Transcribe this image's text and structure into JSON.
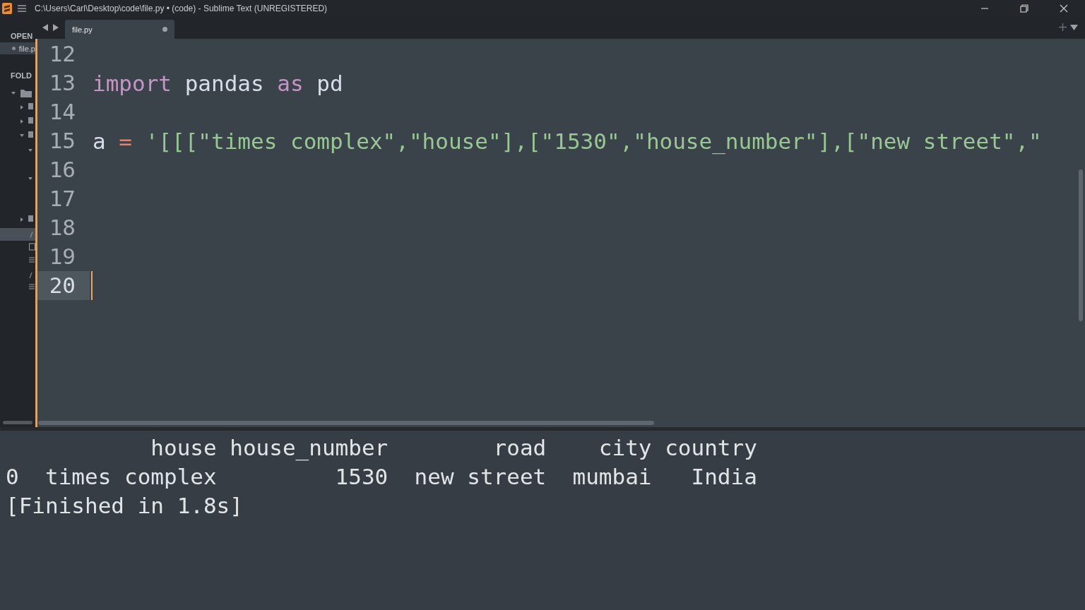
{
  "window": {
    "title": "C:\\Users\\Carl\\Desktop\\code\\file.py • (code) - Sublime Text (UNREGISTERED)"
  },
  "sidebar": {
    "open_label": "OPEN",
    "open_files": [
      {
        "name": "file.p",
        "selected": true
      }
    ],
    "folders_label": "FOLD"
  },
  "tabs": [
    {
      "label": "file.py",
      "selected": true,
      "modified": true
    }
  ],
  "editor": {
    "lines": [
      {
        "number": "12",
        "current": false
      },
      {
        "number": "13",
        "current": false,
        "tokens": [
          {
            "kind": "keyword",
            "text": "import"
          },
          {
            "kind": "plain",
            "text": " pandas "
          },
          {
            "kind": "keyword",
            "text": "as"
          },
          {
            "kind": "plain",
            "text": " pd"
          }
        ]
      },
      {
        "number": "14",
        "current": false
      },
      {
        "number": "15",
        "current": false,
        "tokens": [
          {
            "kind": "plain",
            "text": "a "
          },
          {
            "kind": "operator",
            "text": "="
          },
          {
            "kind": "string",
            "text": " '[[[\"times complex\",\"house\"],[\"1530\",\"house_number\"],[\"new street\",\""
          }
        ]
      },
      {
        "number": "16",
        "current": false
      },
      {
        "number": "17",
        "current": false
      },
      {
        "number": "18",
        "current": false
      },
      {
        "number": "19",
        "current": false
      },
      {
        "number": "20",
        "current": true
      }
    ]
  },
  "output": {
    "lines": [
      "           house house_number        road    city country",
      "0  times complex         1530  new street  mumbai   India",
      "[Finished in 1.8s]"
    ]
  }
}
